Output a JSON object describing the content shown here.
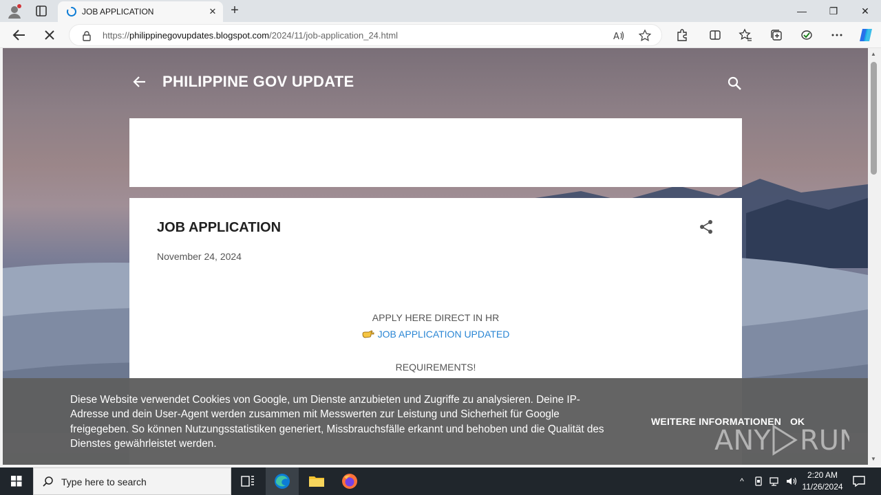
{
  "browser": {
    "tab_title": "JOB APPLICATION",
    "tab_close": "✕",
    "new_tab": "+",
    "url_prefix": "https://",
    "url_domain": "philippinegovupdates.blogspot.com",
    "url_path": "/2024/11/job-application_24.html",
    "window_controls": {
      "minimize": "—",
      "maximize": "❐",
      "close": "✕"
    }
  },
  "blog": {
    "title": "PHILIPPINE GOV UPDATE"
  },
  "post": {
    "title": "JOB APPLICATION",
    "date": "November 24, 2024",
    "line1": "APPLY HERE DIRECT IN HR",
    "link": "JOB APPLICATION UPDATED",
    "requirements": "REQUIREMENTS!"
  },
  "cookie": {
    "text": "Diese Website verwendet Cookies von Google, um Dienste anzubieten und Zugriffe zu analysieren. Deine IP-Adresse und dein User-Agent werden zusammen mit Messwerten zur Leistung und Sicherheit für Google freigegeben. So können Nutzungsstatistiken generiert, Missbrauchsfälle erkannt und behoben und die Qualität des Dienstes gewährleistet werden.",
    "more": "WEITERE INFORMATIONEN",
    "ok": "OK"
  },
  "taskbar": {
    "search_placeholder": "Type here to search",
    "time": "2:20 AM",
    "date": "11/26/2024"
  },
  "colors": {
    "link": "#2a86d4",
    "edge_accent": "#0c7cd5",
    "taskbar": "#20262c"
  }
}
